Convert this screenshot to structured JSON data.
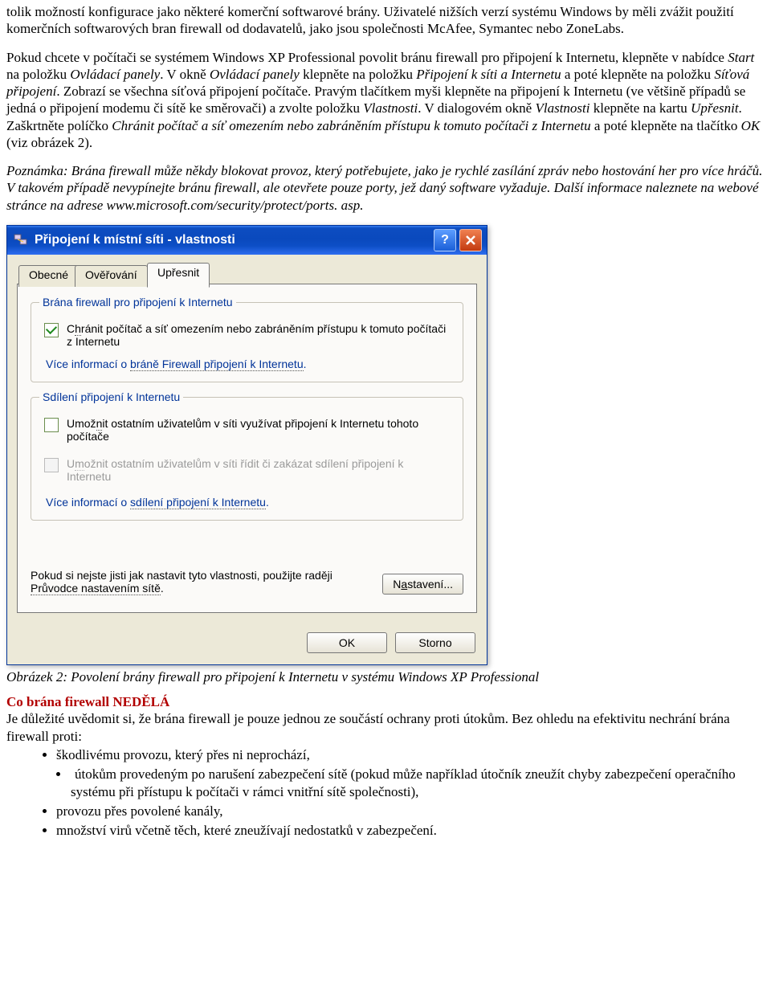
{
  "document": {
    "para1": "tolik možností konfigurace jako některé komerční softwarové brány. Uživatelé nižších verzí systému Windows by měli zvážit použití komerčních softwarových bran firewall od dodavatelů, jako jsou společnosti McAfee, Symantec nebo ZoneLabs.",
    "para2_plain1": "Pokud chcete v počítači se systémem Windows XP Professional povolit bránu firewall pro připojení k Internetu, klepněte v nabídce ",
    "para2_i1": "Start",
    "para2_plain2": " na položku ",
    "para2_i2": "Ovládací panely",
    "para2_plain3": ". V okně ",
    "para2_i3": "Ovládací panely",
    "para2_plain4": " klepněte na položku ",
    "para2_i4": "Připojení k síti a Internetu",
    "para2_plain5": " a poté klepněte na položku ",
    "para2_i5": "Síťová připojení",
    "para2_plain6": ". Zobrazí se všechna síťová připojení počítače. Pravým tlačítkem myši klepněte na připojení k Internetu (ve většině případů se jedná o připojení modemu či sítě ke směrovači) a zvolte položku ",
    "para2_i6": "Vlastnosti",
    "para2_plain7": ". V dialogovém okně ",
    "para2_i7": "Vlastnosti",
    "para2_plain8": " klepněte na kartu ",
    "para2_i8": "Upřesnit",
    "para2_plain9": ". Zaškrtněte políčko ",
    "para2_i9": "Chránit počítač a síť omezením nebo zabráněním přístupu k tomuto počítači z Internetu",
    "para2_plain10": " a poté klepněte na tlačítko ",
    "para2_i10": "OK",
    "para2_plain11": " (viz obrázek 2).",
    "note1": "Poznámka: Brána firewall může někdy blokovat provoz, který potřebujete, jako je rychlé zasílání zpráv nebo hostování her pro více hráčů. V takovém případě nevypínejte bránu firewall, ale otevřete pouze porty, jež daný software vyžaduje. Další informace naleznete na webové stránce na adrese www.microsoft.com/security/protect/ports. asp.",
    "caption": "Obrázek 2: Povolení brány firewall pro připojení k Internetu v systému Windows XP Professional",
    "heading_red": "Co brána firewall NEDĚLÁ",
    "para3": "Je důležité uvědomit si, že brána firewall je pouze jednou ze součástí ochrany proti útokům. Bez ohledu na efektivitu nechrání brána firewall proti:",
    "bullets": [
      "škodlivému provozu, který přes ni neprochází,",
      "útokům provedeným po narušení zabezpečení sítě (pokud může například útočník zneužít chyby zabezpečení operačního systému při přístupu k počítači v rámci vnitřní sítě společnosti),",
      "provozu přes povolené kanály,",
      "množství virů včetně těch, které zneužívají nedostatků v zabezpečení."
    ]
  },
  "dialog": {
    "title": "Připojení k místní síti - vlastnosti",
    "tabs": [
      "Obecné",
      "Ověřování",
      "Upřesnit"
    ],
    "group1": {
      "label": "Brána firewall pro připojení k Internetu",
      "chk_pre": "C",
      "chk_u": "h",
      "chk_post": "ránit počítač a síť omezením nebo zabráněním přístupu k tomuto počítači z Internetu",
      "link_pre": "Více informací o ",
      "link_u": "bráně Firewall připojení k Internetu",
      "link_post": "."
    },
    "group2": {
      "label": "Sdílení připojení k Internetu",
      "chk1_pre": "Umož",
      "chk1_u": "n",
      "chk1_post": "it ostatním uživatelům v síti využívat připojení k Internetu tohoto počítače",
      "chk2_pre": "U",
      "chk2_u": "m",
      "chk2_post": "ožnit ostatním uživatelům v síti řídit či zakázat sdílení připojení k Internetu",
      "link_pre": "Více informací o ",
      "link_u": "sdílení připojení k Internetu",
      "link_post": "."
    },
    "note_pre": "Pokud si nejste jisti jak nastavit tyto vlastnosti, použijte raději ",
    "note_u": "Průvodce nastavením sítě",
    "note_post": ".",
    "btn_settings_pre": "N",
    "btn_settings_u": "a",
    "btn_settings_post": "stavení...",
    "btn_ok": "OK",
    "btn_cancel": "Storno"
  }
}
